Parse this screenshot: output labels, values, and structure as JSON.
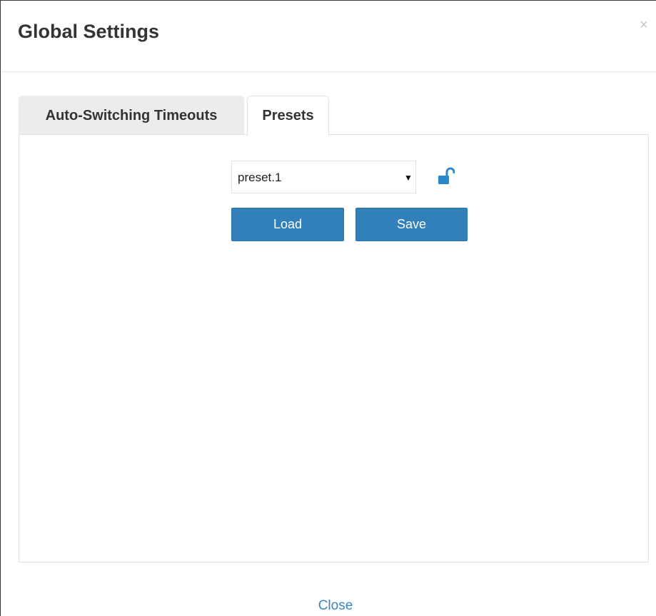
{
  "dialog": {
    "title": "Global Settings",
    "close_symbol": "×",
    "close_icon": "close-icon"
  },
  "tabs": [
    {
      "label": "Auto-Switching Timeouts",
      "active": false
    },
    {
      "label": "Presets",
      "active": true
    }
  ],
  "presets": {
    "selected_value": "preset.1",
    "arrow": "▼",
    "lock_icon": "unlocked-lock-icon",
    "load_label": "Load",
    "save_label": "Save"
  },
  "footer": {
    "close_label": "Close"
  },
  "colors": {
    "primary_button": "#3280b9",
    "link": "#3a86c4",
    "lock_icon": "#2f86c9",
    "inactive_tab": "#ececec"
  }
}
